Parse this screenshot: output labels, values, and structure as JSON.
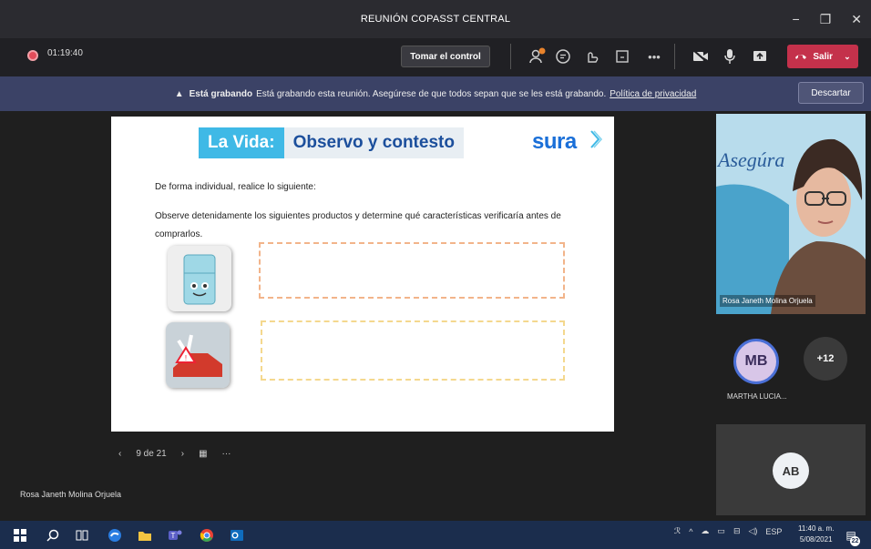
{
  "window": {
    "title": "REUNIÓN COPASST CENTRAL",
    "controls": [
      "−",
      "❐",
      "✕"
    ]
  },
  "toolbar": {
    "timer": "01:19:40",
    "control_label": "Tomar el control",
    "leave_label": "Salir"
  },
  "recording_banner": {
    "title": "Está grabando",
    "message": "Está grabando esta reunión. Asegúrese de que todos sepan que se les está grabando.",
    "privacy_link": "Política de privacidad",
    "dismiss_label": "Descartar"
  },
  "slide": {
    "title_part1": "La Vida:",
    "title_part2": "Observo y contesto",
    "logo": "sura",
    "instruction": "De forma individual, realice lo siguiente:",
    "question": "Observe detenidamente los siguientes productos y determine qué características verificaría antes de comprarlos."
  },
  "pager": {
    "page_label": "9 de 21"
  },
  "presenter_name": "Rosa Janeth Molina Orjuela",
  "participants": {
    "video_name": "Rosa Janeth Molina Orjuela",
    "video_bg_text": "Asegúra",
    "mb_initials": "MB",
    "mb_name": "MARTHA LUCIA...",
    "more_count": "+12",
    "ab_initials": "AB"
  },
  "taskbar": {
    "lang": "ESP",
    "time": "11:40 a. m.",
    "date": "5/08/2021",
    "notifications": "22"
  },
  "colors": {
    "titlebar": "#2b2b30",
    "toolbar": "#202024",
    "banner": "#3b4266",
    "leave": "#c4314b",
    "taskbar": "#1b2d4d",
    "title_accent": "#3fb9e6",
    "title_text": "#1c4f9c"
  }
}
